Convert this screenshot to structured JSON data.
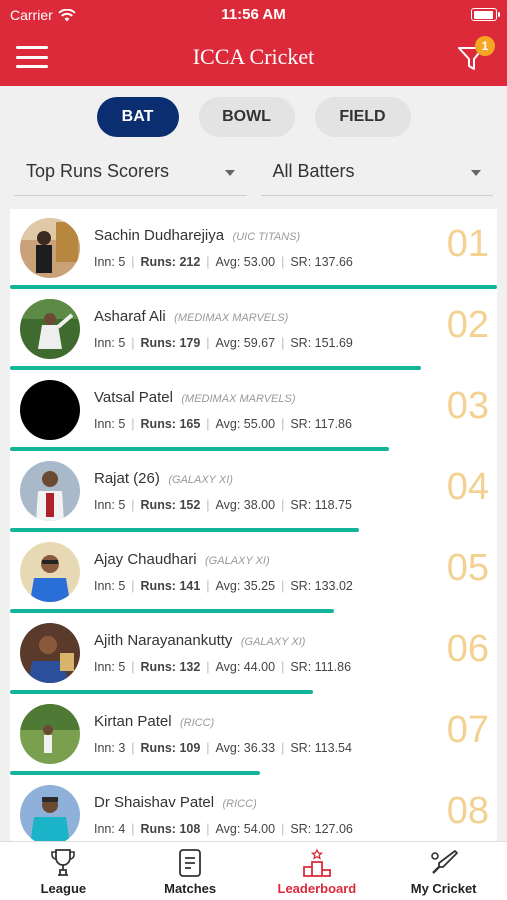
{
  "status": {
    "carrier": "Carrier",
    "time": "11:56 AM"
  },
  "header": {
    "title": "ICCA Cricket",
    "filter_count": "1"
  },
  "tabs": [
    {
      "label": "BAT"
    },
    {
      "label": "BOWL"
    },
    {
      "label": "FIELD"
    }
  ],
  "filters": {
    "category": "Top Runs Scorers",
    "group": "All Batters"
  },
  "colors": {
    "brand": "#dc2a3a",
    "active_tab": "#0b2e70",
    "bar": "#13b59a",
    "rank": "#f3d190"
  },
  "players": [
    {
      "name": "Sachin Dudharejiya",
      "team": "(UIC TITANS)",
      "inn": "Inn: 5",
      "runs_label": "Runs:",
      "runs": "212",
      "avg": "Avg: 53.00",
      "sr": "SR: 137.66",
      "rank": "01",
      "bar": 1.0
    },
    {
      "name": "Asharaf Ali",
      "team": "(MEDIMAX MARVELS)",
      "inn": "Inn: 5",
      "runs_label": "Runs:",
      "runs": "179",
      "avg": "Avg: 59.67",
      "sr": "SR: 151.69",
      "rank": "02",
      "bar": 0.844
    },
    {
      "name": "Vatsal Patel",
      "team": "(MEDIMAX MARVELS)",
      "inn": "Inn: 5",
      "runs_label": "Runs:",
      "runs": "165",
      "avg": "Avg: 55.00",
      "sr": "SR: 117.86",
      "rank": "03",
      "bar": 0.778
    },
    {
      "name": "Rajat (26)",
      "team": "(GALAXY XI)",
      "inn": "Inn: 5",
      "runs_label": "Runs:",
      "runs": "152",
      "avg": "Avg: 38.00",
      "sr": "SR: 118.75",
      "rank": "04",
      "bar": 0.717
    },
    {
      "name": "Ajay Chaudhari",
      "team": "(GALAXY XI)",
      "inn": "Inn: 5",
      "runs_label": "Runs:",
      "runs": "141",
      "avg": "Avg: 35.25",
      "sr": "SR: 133.02",
      "rank": "05",
      "bar": 0.665
    },
    {
      "name": "Ajith Narayanankutty",
      "team": "(GALAXY XI)",
      "inn": "Inn: 5",
      "runs_label": "Runs:",
      "runs": "132",
      "avg": "Avg: 44.00",
      "sr": "SR: 111.86",
      "rank": "06",
      "bar": 0.623
    },
    {
      "name": "Kirtan Patel",
      "team": "(RICC)",
      "inn": "Inn: 3",
      "runs_label": "Runs:",
      "runs": "109",
      "avg": "Avg: 36.33",
      "sr": "SR: 113.54",
      "rank": "07",
      "bar": 0.514
    },
    {
      "name": "Dr Shaishav Patel",
      "team": "(RICC)",
      "inn": "Inn: 4",
      "runs_label": "Runs:",
      "runs": "108",
      "avg": "Avg: 54.00",
      "sr": "SR: 127.06",
      "rank": "08",
      "bar": 0.509
    }
  ],
  "bottom_nav": [
    {
      "label": "League",
      "icon": "trophy-icon"
    },
    {
      "label": "Matches",
      "icon": "scorecard-icon"
    },
    {
      "label": "Leaderboard",
      "icon": "podium-icon"
    },
    {
      "label": "My Cricket",
      "icon": "bat-icon"
    }
  ]
}
